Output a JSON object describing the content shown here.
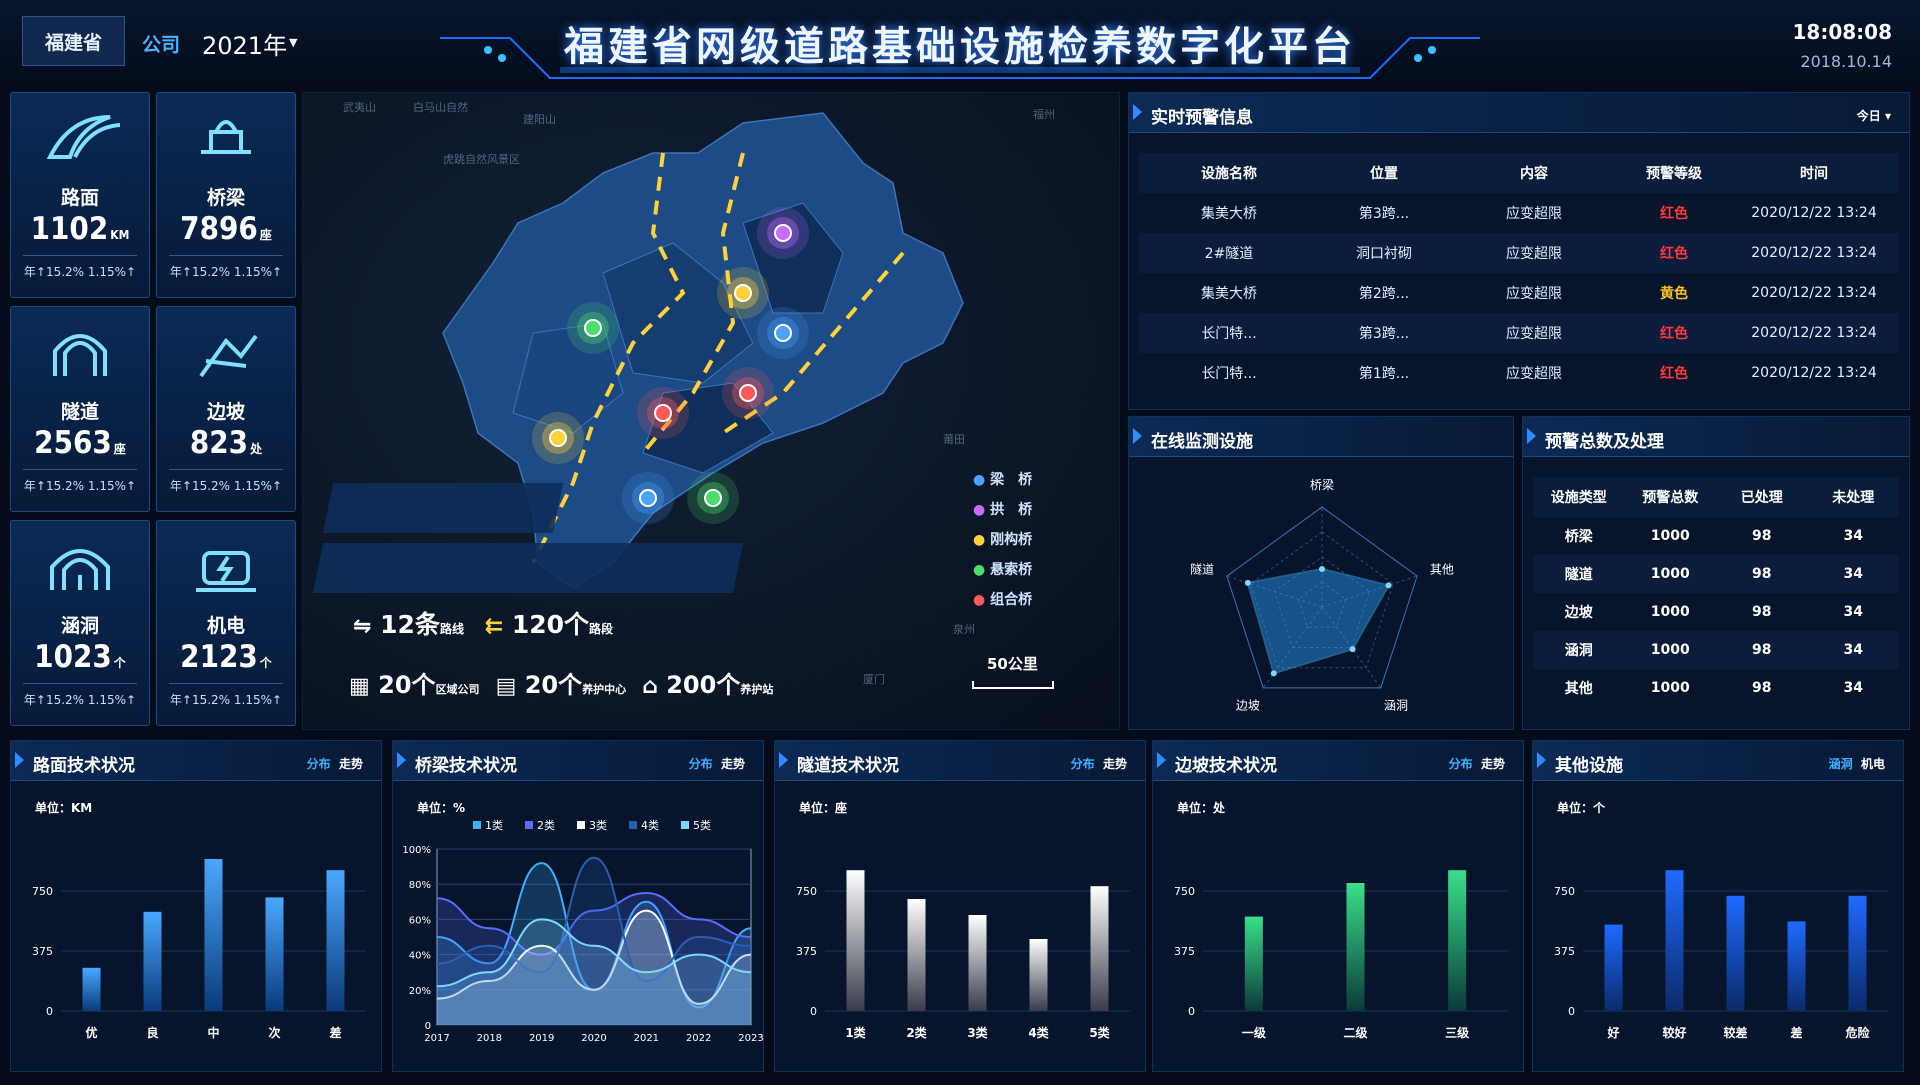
{
  "header": {
    "province": "福建省",
    "company": "公司",
    "year": "2021年",
    "title": "福建省网级道路基础设施检养数字化平台",
    "time": "18:08:08",
    "date": "2018.10.14"
  },
  "stats": [
    {
      "name": "路面",
      "value": "1102",
      "unit": "KM",
      "yoy": "年↑15.2% 1.15%↑",
      "icon": "road-icon"
    },
    {
      "name": "桥梁",
      "value": "7896",
      "unit": "座",
      "yoy": "年↑15.2% 1.15%↑",
      "icon": "bridge-icon"
    },
    {
      "name": "隧道",
      "value": "2563",
      "unit": "座",
      "yoy": "年↑15.2% 1.15%↑",
      "icon": "tunnel-icon"
    },
    {
      "name": "边坡",
      "value": "823",
      "unit": "处",
      "yoy": "年↑15.2% 1.15%↑",
      "icon": "slope-icon"
    },
    {
      "name": "涵洞",
      "value": "1023",
      "unit": "个",
      "yoy": "年↑15.2% 1.15%↑",
      "icon": "culvert-icon"
    },
    {
      "name": "机电",
      "value": "2123",
      "unit": "个",
      "yoy": "年↑15.2% 1.15%↑",
      "icon": "electro-icon"
    }
  ],
  "map": {
    "routes": {
      "num": "12条",
      "label": "路线",
      "seg_num": "120个",
      "seg_label": "路段"
    },
    "orgs": [
      {
        "num": "20个",
        "label": "区域公司"
      },
      {
        "num": "20个",
        "label": "养护中心"
      },
      {
        "num": "200个",
        "label": "养护站"
      }
    ],
    "scale": "50公里",
    "legend": [
      {
        "label": "梁　桥",
        "color": "#4ea3ff"
      },
      {
        "label": "拱　桥",
        "color": "#c86cff"
      },
      {
        "label": "刚构桥",
        "color": "#ffd23a"
      },
      {
        "label": "悬索桥",
        "color": "#4cdc6c"
      },
      {
        "label": "组合桥",
        "color": "#ff5a5a"
      }
    ],
    "bg_labels": [
      "武夷山",
      "白马山自然",
      "虎跳自然风景区",
      "建阳山",
      "福州",
      "厦门",
      "泉州",
      "莆田"
    ]
  },
  "alerts": {
    "title": "实时预警信息",
    "filter": "今日",
    "headers": [
      "设施名称",
      "位置",
      "内容",
      "预警等级",
      "时间"
    ],
    "rows": [
      [
        "集美大桥",
        "第3跨...",
        "应变超限",
        "红色",
        "2020/12/22 13:24"
      ],
      [
        "2#隧道",
        "洞口衬砌",
        "应变超限",
        "红色",
        "2020/12/22 13:24"
      ],
      [
        "集美大桥",
        "第2跨...",
        "应变超限",
        "黄色",
        "2020/12/22 13:24"
      ],
      [
        "长门特...",
        "第3跨...",
        "应变超限",
        "红色",
        "2020/12/22 13:24"
      ],
      [
        "长门特...",
        "第1跨...",
        "应变超限",
        "红色",
        "2020/12/22 13:24"
      ]
    ],
    "level_colors": {
      "红色": "#ff3b3b",
      "黄色": "#ffc21a"
    }
  },
  "monitor": {
    "title": "在线监测设施",
    "axes": [
      "桥梁",
      "其他",
      "涵洞",
      "边坡",
      "隧道"
    ],
    "values": [
      0.38,
      0.7,
      0.52,
      0.82,
      0.78
    ]
  },
  "warncount": {
    "title": "预警总数及处理",
    "headers": [
      "设施类型",
      "预警总数",
      "已处理",
      "未处理"
    ],
    "rows": [
      [
        "桥梁",
        "1000",
        "98",
        "34"
      ],
      [
        "隧道",
        "1000",
        "98",
        "34"
      ],
      [
        "边坡",
        "1000",
        "98",
        "34"
      ],
      [
        "涵洞",
        "1000",
        "98",
        "34"
      ],
      [
        "其他",
        "1000",
        "98",
        "34"
      ]
    ]
  },
  "bottom": [
    {
      "title": "路面技术状况",
      "tab1": "分布",
      "tab2": "走势",
      "unit": "单位：KM"
    },
    {
      "title": "桥梁技术状况",
      "tab1": "分布",
      "tab2": "走势",
      "unit": "单位：%"
    },
    {
      "title": "隧道技术状况",
      "tab1": "分布",
      "tab2": "走势",
      "unit": "单位：座"
    },
    {
      "title": "边坡技术状况",
      "tab1": "分布",
      "tab2": "走势",
      "unit": "单位：处"
    },
    {
      "title": "其他设施",
      "tab1": "涵洞",
      "tab2": "机电",
      "unit": "单位：个"
    }
  ],
  "chart_data": [
    {
      "type": "bar",
      "categories": [
        "优",
        "良",
        "中",
        "次",
        "差"
      ],
      "values": [
        270,
        620,
        950,
        710,
        880
      ],
      "ylim": [
        0,
        1000
      ],
      "yticks": [
        "0",
        "375",
        "750"
      ],
      "colors": [
        "#4aa8ff",
        "#0a3a7a"
      ]
    },
    {
      "type": "area",
      "categories": [
        "2017",
        "2018",
        "2019",
        "2020",
        "2021",
        "2022",
        "2023"
      ],
      "yticks": [
        "0",
        "20%",
        "40%",
        "60%",
        "80%",
        "100%"
      ],
      "ylim": [
        0,
        100
      ],
      "legend": [
        "1类",
        "2类",
        "3类",
        "4类",
        "5类"
      ],
      "series": [
        {
          "name": "1类",
          "values": [
            50,
            35,
            92,
            20,
            70,
            10,
            55
          ],
          "color": "#3fb0ff"
        },
        {
          "name": "2类",
          "values": [
            72,
            55,
            40,
            65,
            75,
            60,
            50
          ],
          "color": "#5a6cff"
        },
        {
          "name": "3类",
          "values": [
            15,
            25,
            45,
            20,
            65,
            12,
            40
          ],
          "color": "#ffffff"
        },
        {
          "name": "4类",
          "values": [
            35,
            45,
            30,
            95,
            25,
            50,
            45
          ],
          "color": "#2a5fb0"
        },
        {
          "name": "5类",
          "values": [
            22,
            30,
            60,
            45,
            30,
            40,
            30
          ],
          "color": "#7fd6ff"
        }
      ]
    },
    {
      "type": "bar",
      "categories": [
        "1类",
        "2类",
        "3类",
        "4类",
        "5类"
      ],
      "values": [
        880,
        700,
        600,
        450,
        780
      ],
      "ylim": [
        0,
        1000
      ],
      "yticks": [
        "0",
        "375",
        "750"
      ],
      "colors": [
        "#ffffff",
        "#3a3a4a"
      ]
    },
    {
      "type": "bar",
      "categories": [
        "一级",
        "二级",
        "三级"
      ],
      "values": [
        590,
        800,
        880
      ],
      "ylim": [
        0,
        1000
      ],
      "yticks": [
        "0",
        "375",
        "750"
      ],
      "colors": [
        "#3adf8a",
        "#0b3a3a"
      ]
    },
    {
      "type": "bar",
      "categories": [
        "好",
        "较好",
        "较差",
        "差",
        "危险"
      ],
      "values": [
        540,
        880,
        720,
        560,
        720
      ],
      "ylim": [
        0,
        1000
      ],
      "yticks": [
        "0",
        "375",
        "750"
      ],
      "colors": [
        "#1e6bff",
        "#0b2a6a"
      ]
    }
  ]
}
